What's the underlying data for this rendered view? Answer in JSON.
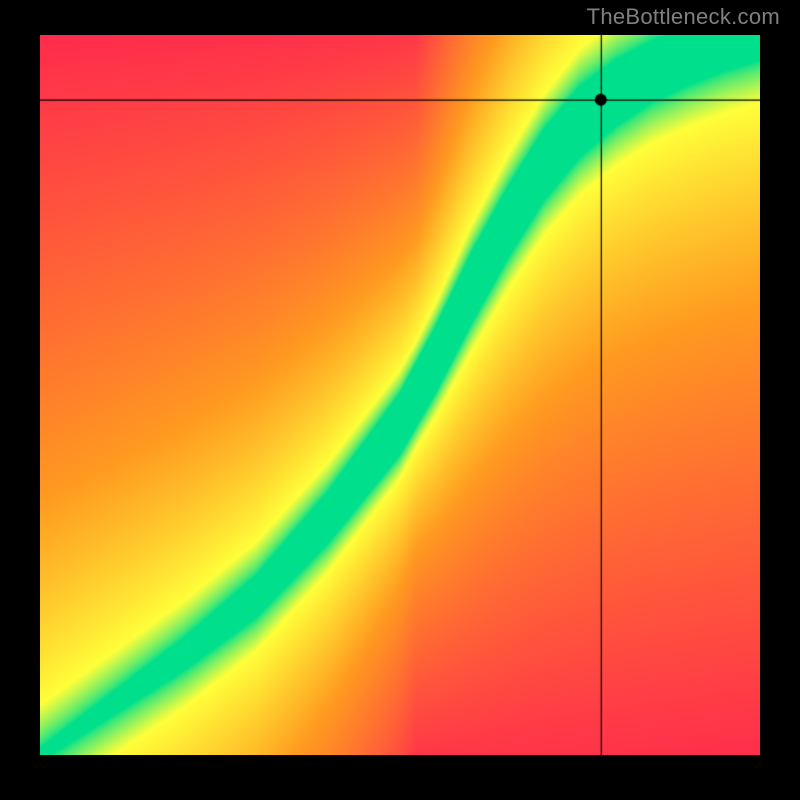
{
  "watermark": "TheBottleneck.com",
  "chart_data": {
    "type": "heatmap",
    "title": "",
    "xlabel": "",
    "ylabel": "",
    "x_range": [
      0,
      100
    ],
    "y_range": [
      0,
      100
    ],
    "crosshair": {
      "x": 78,
      "y": 91
    },
    "marker": {
      "x": 78,
      "y": 91
    },
    "color_scale": {
      "optimal": "#00E08C",
      "near": "#FFFF3A",
      "far": "#FF9A20",
      "worst": "#FF2A4D"
    },
    "optimal_curve_points": [
      {
        "x": 0,
        "y": 0
      },
      {
        "x": 10,
        "y": 7
      },
      {
        "x": 20,
        "y": 14
      },
      {
        "x": 30,
        "y": 22
      },
      {
        "x": 40,
        "y": 33
      },
      {
        "x": 50,
        "y": 46
      },
      {
        "x": 55,
        "y": 55
      },
      {
        "x": 60,
        "y": 65
      },
      {
        "x": 65,
        "y": 74
      },
      {
        "x": 70,
        "y": 82
      },
      {
        "x": 75,
        "y": 88
      },
      {
        "x": 80,
        "y": 92
      },
      {
        "x": 85,
        "y": 95
      },
      {
        "x": 90,
        "y": 97
      },
      {
        "x": 95,
        "y": 98.5
      },
      {
        "x": 100,
        "y": 99.5
      }
    ],
    "band_halfwidth_points": [
      {
        "x": 0,
        "w": 1
      },
      {
        "x": 15,
        "w": 2
      },
      {
        "x": 30,
        "w": 3
      },
      {
        "x": 45,
        "w": 4
      },
      {
        "x": 60,
        "w": 5
      },
      {
        "x": 75,
        "w": 5
      },
      {
        "x": 90,
        "w": 4
      },
      {
        "x": 100,
        "w": 3
      }
    ]
  }
}
